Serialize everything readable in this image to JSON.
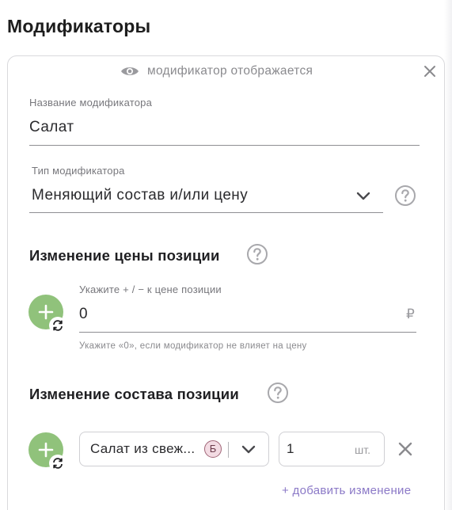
{
  "page": {
    "title": "Модификаторы"
  },
  "modifier": {
    "visibility_text": "модификатор отображается",
    "name_label": "Название модификатора",
    "name_value": "Салат",
    "type_label": "Тип модификатора",
    "type_value": "Меняющий состав и/или цену"
  },
  "price_change": {
    "title": "Изменение цены позиции",
    "input_label": "Укажите + / − к цене позиции",
    "input_value": "0",
    "currency": "₽",
    "hint": "Укажите «0», если модификатор не влияет на цену"
  },
  "composition_change": {
    "title": "Изменение состава позиции",
    "rows": [
      {
        "item": "Салат из свеж...",
        "badge": "Б",
        "quantity": "1",
        "unit": "шт."
      }
    ],
    "add_label": "+ добавить изменение"
  },
  "colors": {
    "accent_green": "#90c27b",
    "link_purple": "#8b79c7",
    "badge_pink": "#f3dbe3"
  }
}
